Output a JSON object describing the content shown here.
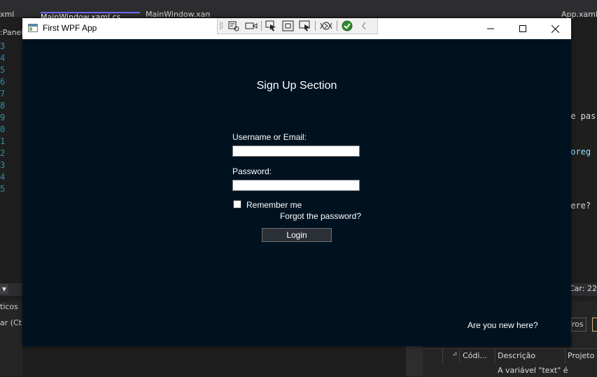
{
  "ide": {
    "tabs": [
      "xml",
      "MainWindow.xaml.cs",
      "MainWindow.xaml",
      "App.xaml"
    ],
    "left_label": ":Panel",
    "line_numbers": [
      "3",
      "4",
      "5",
      "6",
      "7",
      "8",
      "9",
      "0",
      "1",
      "2",
      "3",
      "4",
      "5"
    ],
    "code_fragments": [
      "he pas",
      "Foreg",
      "here?"
    ],
    "caret_position": "Car: 22",
    "output_panel_title": "ticos",
    "search_hint": "ar (Ctrl",
    "filter_label": "ros",
    "error_list": {
      "columns": [
        "Códi...",
        "Descrição",
        "Projeto"
      ],
      "first_row_description": "A variável \"text\" é"
    }
  },
  "window": {
    "title": "First WPF App",
    "section_title": "Sign Up Section",
    "username_label": "Username or Email:",
    "username_value": "",
    "password_label": "Password:",
    "password_value": "",
    "remember_label": "Remember me",
    "remember_checked": false,
    "forgot_link": "Forgot the password?",
    "login_button": "Login",
    "new_here_link": "Are you new here?"
  },
  "colors": {
    "window_background": "#001220",
    "ide_background": "#1e1e1e",
    "line_number": "#2b91af",
    "accent": "#6c6cff"
  },
  "icons": {
    "app": "wpf-window-icon",
    "minimize": "minimize-icon",
    "maximize": "maximize-icon",
    "close": "close-icon",
    "debug_tools": [
      "grip-icon",
      "select-element-icon",
      "display-layout-adorners-icon",
      "track-focus-icon",
      "preview-selection-icon",
      "hot-reload-icon",
      "status-ok-icon",
      "collapse-toolbar-icon"
    ]
  }
}
